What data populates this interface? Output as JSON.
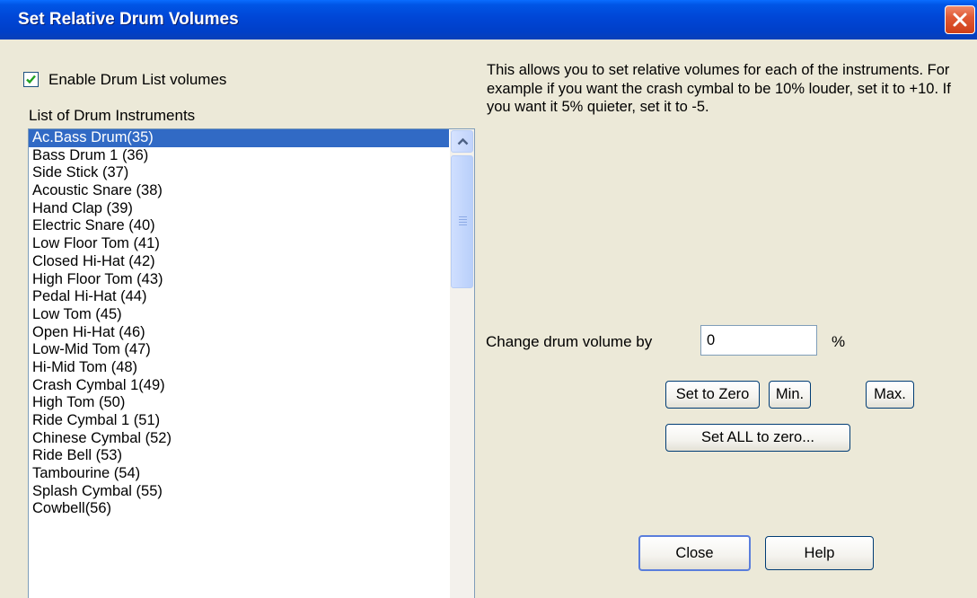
{
  "window": {
    "title": "Set Relative Drum Volumes"
  },
  "enable_checkbox": {
    "label": "Enable Drum List volumes",
    "checked": true
  },
  "list": {
    "label": "List of Drum Instruments",
    "selected_index": 0,
    "items": [
      "Ac.Bass Drum(35)",
      "Bass Drum 1 (36)",
      "Side Stick (37)",
      "Acoustic Snare (38)",
      "Hand Clap (39)",
      "Electric Snare (40)",
      "Low Floor Tom (41)",
      "Closed Hi-Hat (42)",
      "High Floor Tom (43)",
      "Pedal Hi-Hat (44)",
      "Low Tom  (45)",
      "Open Hi-Hat (46)",
      "Low-Mid Tom  (47)",
      "Hi-Mid Tom (48)",
      "Crash Cymbal 1(49)",
      "High Tom (50)",
      "Ride Cymbal 1 (51)",
      "Chinese Cymbal (52)",
      "Ride Bell (53)",
      "Tambourine (54)",
      "Splash Cymbal (55)",
      "Cowbell(56)"
    ]
  },
  "description": "This allows you to set relative volumes for each of the instruments. For example if you want the crash cymbal to be 10% louder,  set it to +10. If you want it 5% quieter, set it to -5.",
  "volume": {
    "label": "Change drum volume by",
    "value": "0",
    "unit": "%"
  },
  "buttons": {
    "set_to_zero": "Set to Zero",
    "min": "Min.",
    "max": "Max.",
    "set_all_zero": "Set ALL to zero...",
    "close": "Close",
    "help": "Help"
  },
  "colors": {
    "titlebar": "#0055e5",
    "dialog_bg": "#ece9d8",
    "selection": "#316ac5",
    "close_button": "#e05a35"
  }
}
